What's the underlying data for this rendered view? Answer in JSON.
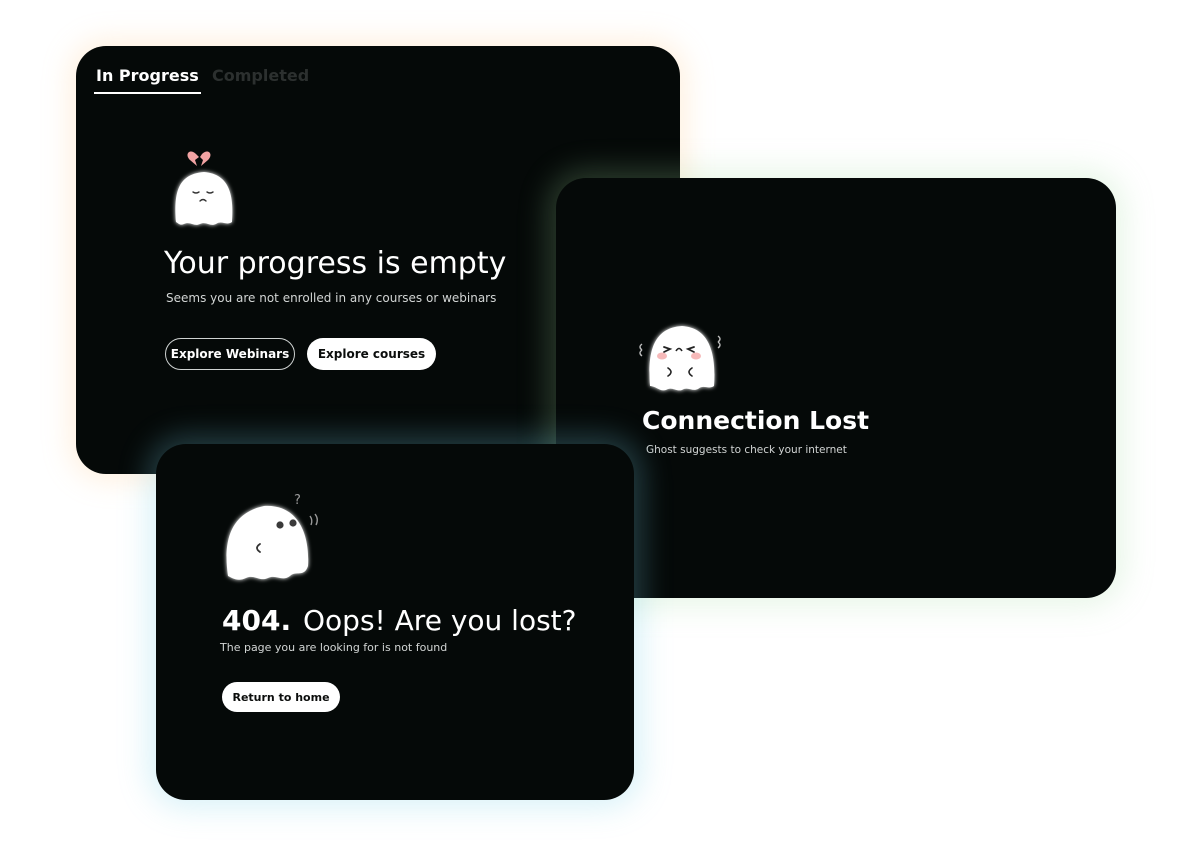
{
  "progress_card": {
    "tabs": [
      {
        "label": "In Progress",
        "active": true
      },
      {
        "label": "Completed",
        "active": false
      }
    ],
    "title": "Your progress is empty",
    "subtitle": "Seems you are not enrolled in any courses or webinars",
    "buttons": {
      "explore_webinars": "Explore Webinars",
      "explore_courses": "Explore courses"
    },
    "illustration": "sad-ghost-broken-heart-icon"
  },
  "connection_card": {
    "title": "Connection Lost",
    "subtitle": "Ghost suggests to check your internet",
    "illustration": "crying-ghost-icon"
  },
  "not_found_card": {
    "code": "404.",
    "title": "Oops! Are you lost?",
    "subtitle": "The page you are looking for is not found",
    "button": "Return to home",
    "illustration": "confused-ghost-icon"
  },
  "colors": {
    "card_background": "#050908",
    "text": "#ffffff",
    "inactive_tab": "#2c302f",
    "heart": "#f2a3a3",
    "blush": "#f6b9b9"
  }
}
